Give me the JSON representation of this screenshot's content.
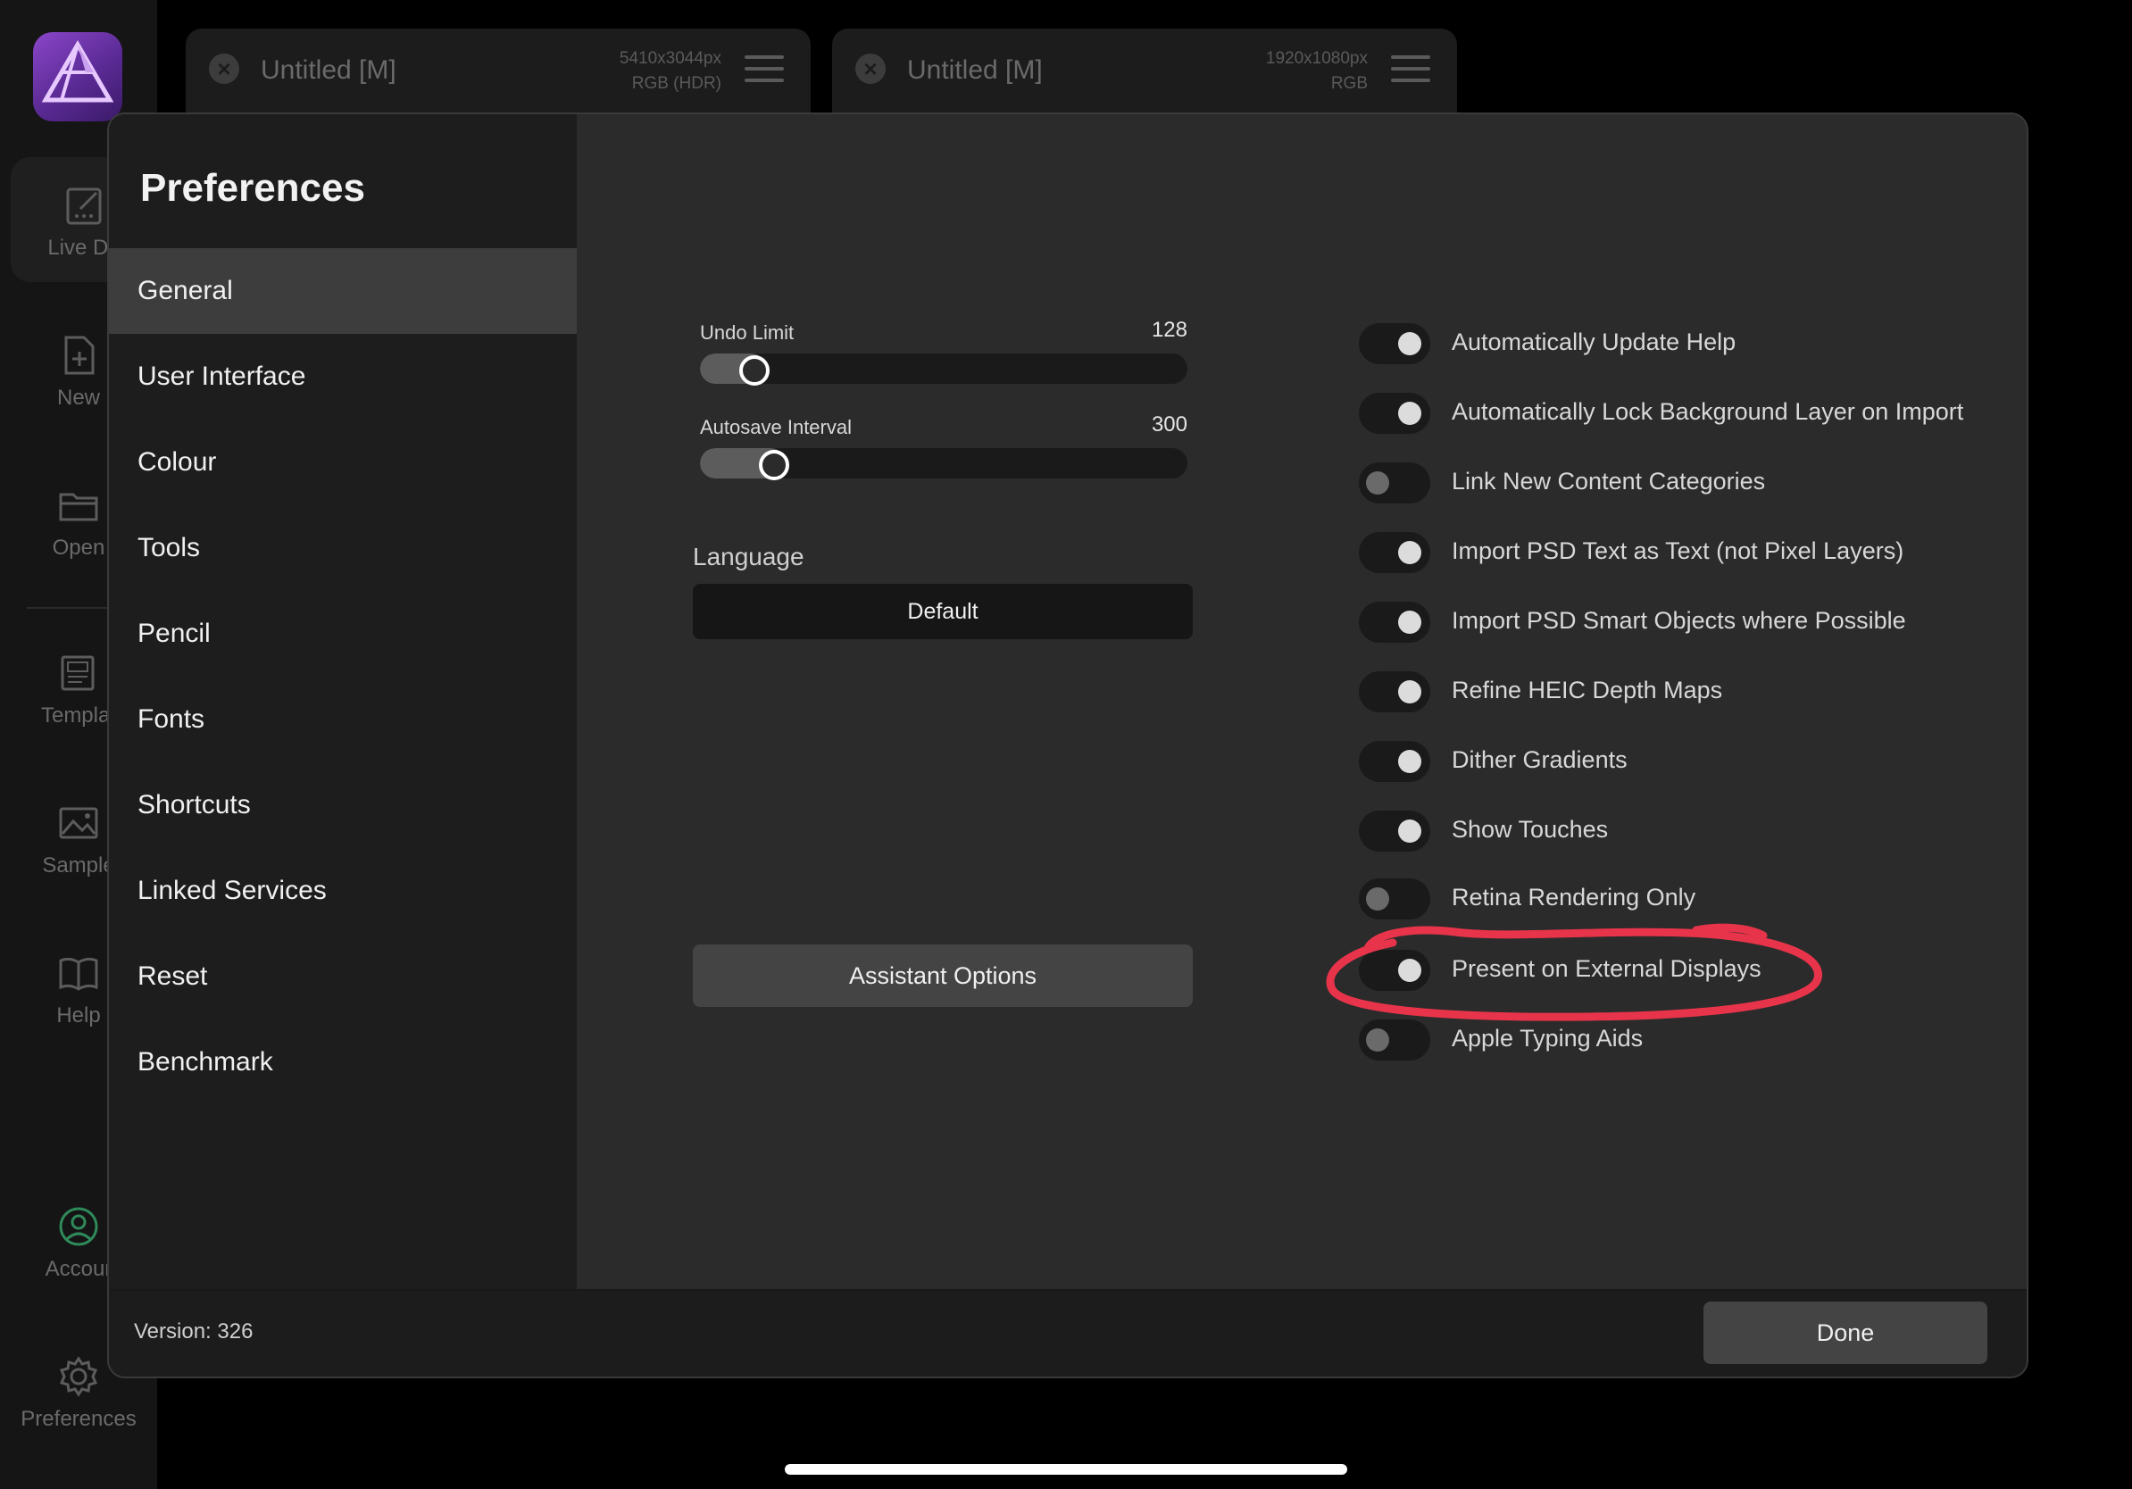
{
  "rail": {
    "items": [
      {
        "label": "Live Do",
        "icon": "live-document-icon"
      },
      {
        "label": "New",
        "icon": "new-document-icon"
      },
      {
        "label": "Open",
        "icon": "folder-icon"
      },
      {
        "label": "Templat",
        "icon": "template-icon"
      },
      {
        "label": "Sample",
        "icon": "image-icon"
      },
      {
        "label": "Help",
        "icon": "book-icon"
      },
      {
        "label": "Accour",
        "icon": "account-icon"
      },
      {
        "label": "Preferences",
        "icon": "gear-icon"
      }
    ]
  },
  "tabs": [
    {
      "title": "Untitled [M]",
      "size": "5410x3044px",
      "color_mode": "RGB (HDR)"
    },
    {
      "title": "Untitled [M]",
      "size": "1920x1080px",
      "color_mode": "RGB"
    }
  ],
  "modal": {
    "title": "Preferences",
    "nav": [
      "General",
      "User Interface",
      "Colour",
      "Tools",
      "Pencil",
      "Fonts",
      "Shortcuts",
      "Linked Services",
      "Reset",
      "Benchmark"
    ],
    "active_nav": "General",
    "sliders": {
      "undo": {
        "label": "Undo Limit",
        "value": "128",
        "fill_fraction": 0.08
      },
      "autosave": {
        "label": "Autosave Interval",
        "value": "300",
        "fill_fraction": 0.12
      }
    },
    "language": {
      "label": "Language",
      "value": "Default"
    },
    "assistant_button": "Assistant Options",
    "toggles": [
      {
        "label": "Automatically Update Help",
        "on": true
      },
      {
        "label": "Automatically Lock Background Layer on Import",
        "on": true
      },
      {
        "label": "Link New Content Categories",
        "on": false
      },
      {
        "label": "Import PSD Text as Text (not Pixel Layers)",
        "on": true
      },
      {
        "label": "Import PSD Smart Objects where Possible",
        "on": true
      },
      {
        "label": "Refine HEIC Depth Maps",
        "on": true
      },
      {
        "label": "Dither Gradients",
        "on": true
      },
      {
        "label": "Show Touches",
        "on": true
      },
      {
        "label": "Retina Rendering Only",
        "on": false
      },
      {
        "label": "Present on External Displays",
        "on": true
      },
      {
        "label": "Apple Typing Aids",
        "on": false
      }
    ],
    "highlighted_toggle": "Present on External Displays",
    "annotation_color": "#e8344a",
    "footer": {
      "version": "Version: 326",
      "done": "Done"
    }
  },
  "colors": {
    "accent_logo": "#7a3cc0",
    "background": "#000000",
    "panel": "#2b2b2b"
  }
}
